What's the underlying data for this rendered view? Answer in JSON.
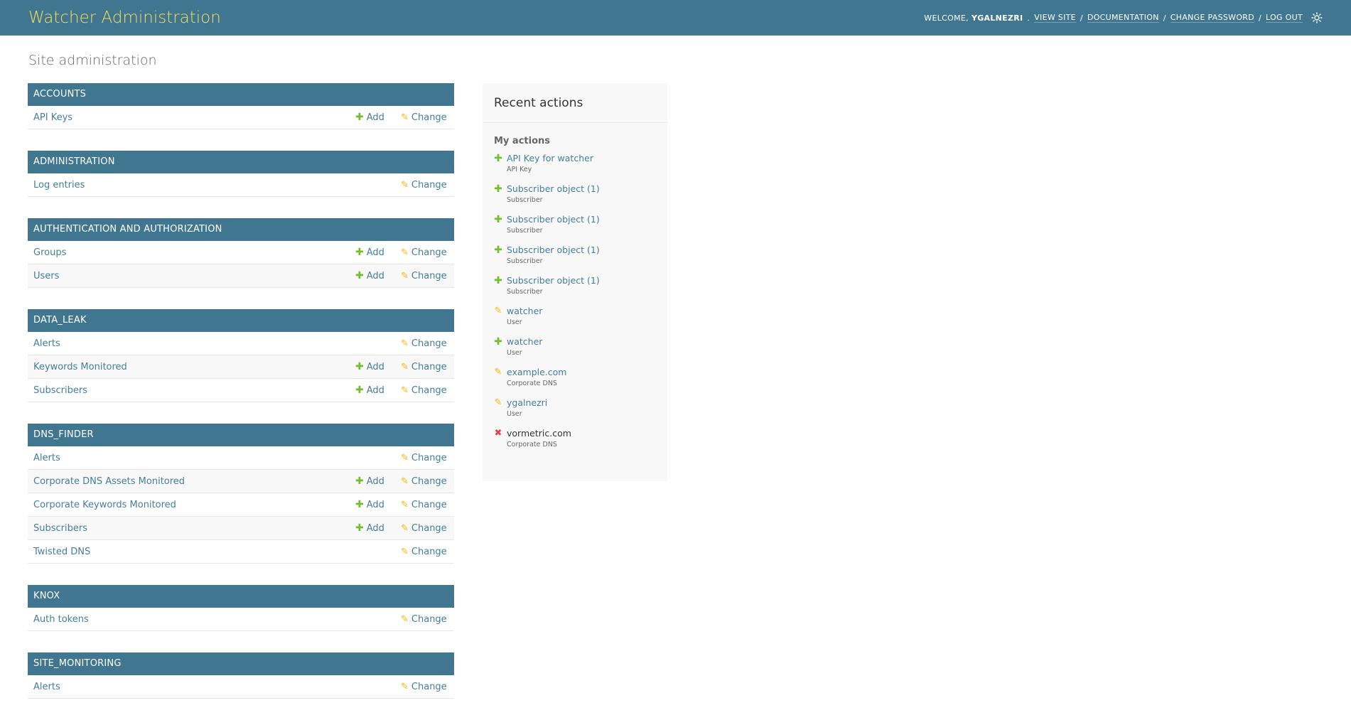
{
  "header": {
    "branding": "Watcher Administration",
    "welcome": "Welcome,",
    "username": "ygalnezri",
    "view_site": "View site",
    "documentation": "Documentation",
    "change_password": "Change password",
    "log_out": "Log out"
  },
  "page_title": "Site administration",
  "labels": {
    "add": "Add",
    "change": "Change"
  },
  "modules": [
    {
      "name": "Accounts",
      "rows": [
        {
          "name": "API Keys",
          "add": true
        }
      ]
    },
    {
      "name": "Administration",
      "rows": [
        {
          "name": "Log entries",
          "add": false
        }
      ]
    },
    {
      "name": "Authentication and Authorization",
      "rows": [
        {
          "name": "Groups",
          "add": true
        },
        {
          "name": "Users",
          "add": true
        }
      ]
    },
    {
      "name": "Data_Leak",
      "rows": [
        {
          "name": "Alerts",
          "add": false
        },
        {
          "name": "Keywords Monitored",
          "add": true
        },
        {
          "name": "Subscribers",
          "add": true
        }
      ]
    },
    {
      "name": "Dns_Finder",
      "rows": [
        {
          "name": "Alerts",
          "add": false
        },
        {
          "name": "Corporate DNS Assets Monitored",
          "add": true
        },
        {
          "name": "Corporate Keywords Monitored",
          "add": true
        },
        {
          "name": "Subscribers",
          "add": true
        },
        {
          "name": "Twisted DNS",
          "add": false
        }
      ]
    },
    {
      "name": "Knox",
      "rows": [
        {
          "name": "Auth tokens",
          "add": false
        }
      ]
    },
    {
      "name": "Site_Monitoring",
      "rows": [
        {
          "name": "Alerts",
          "add": false
        }
      ]
    }
  ],
  "recent": {
    "title": "Recent actions",
    "my_actions": "My actions",
    "items": [
      {
        "kind": "add",
        "label": "API Key for watcher",
        "type": "API Key"
      },
      {
        "kind": "add",
        "label": "Subscriber object (1)",
        "type": "Subscriber"
      },
      {
        "kind": "add",
        "label": "Subscriber object (1)",
        "type": "Subscriber"
      },
      {
        "kind": "add",
        "label": "Subscriber object (1)",
        "type": "Subscriber"
      },
      {
        "kind": "add",
        "label": "Subscriber object (1)",
        "type": "Subscriber"
      },
      {
        "kind": "change",
        "label": "watcher",
        "type": "User"
      },
      {
        "kind": "add",
        "label": "watcher",
        "type": "User"
      },
      {
        "kind": "change",
        "label": "example.com",
        "type": "Corporate DNS"
      },
      {
        "kind": "change",
        "label": "ygalnezri",
        "type": "User"
      },
      {
        "kind": "delete",
        "label": "vormetric.com",
        "type": "Corporate DNS"
      }
    ]
  },
  "colors": {
    "header_bg": "#417690",
    "branding": "#f5dd5d",
    "link": "#447e9b",
    "add_icon": "#70bf2b",
    "change_icon": "#efb80b",
    "delete_icon": "#dd4646"
  },
  "icons": {
    "theme_toggle": "sun-icon",
    "add": "plus-icon",
    "change": "pencil-icon",
    "delete": "delete-icon"
  }
}
